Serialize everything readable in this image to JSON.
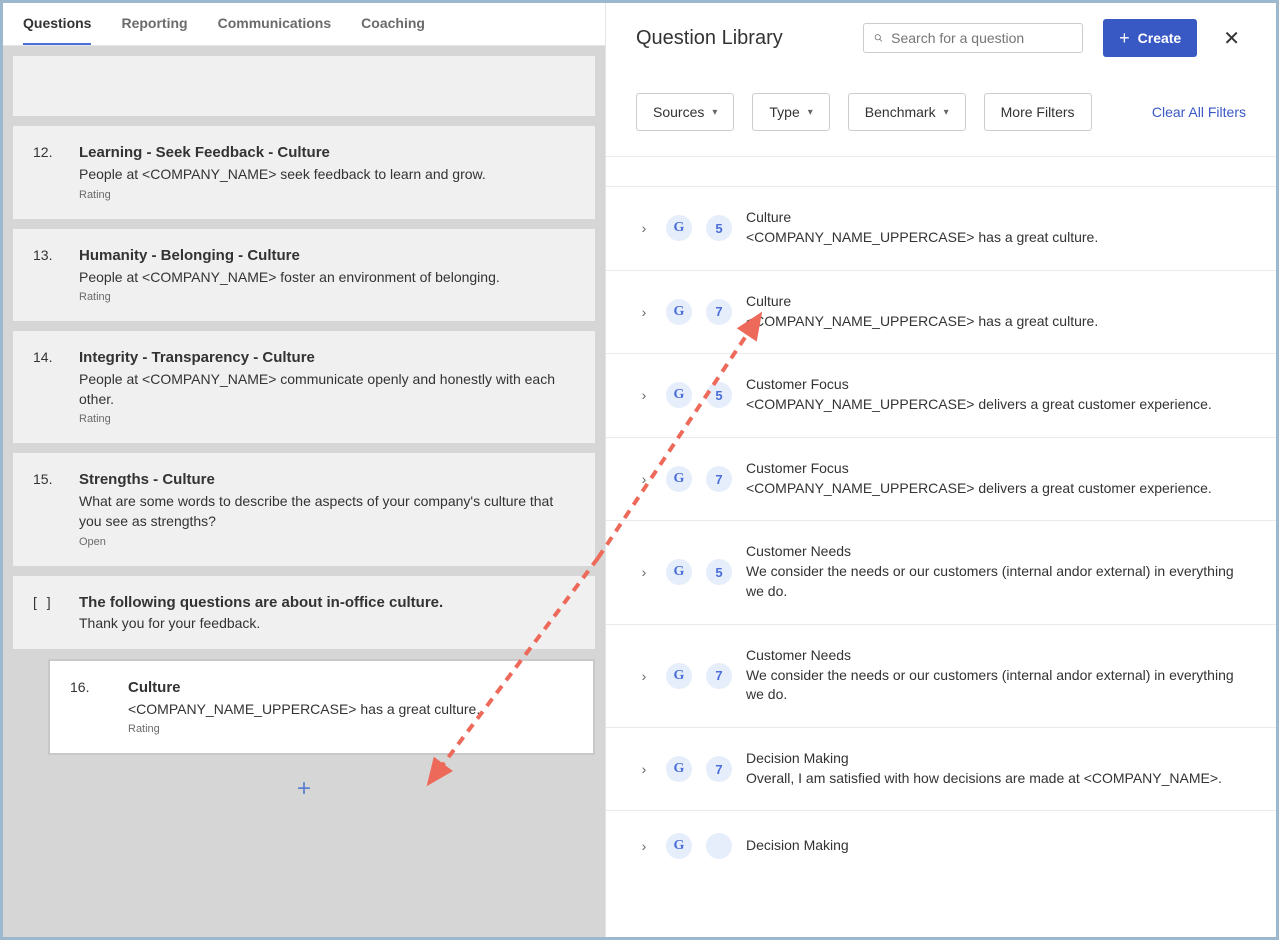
{
  "tabs": [
    "Questions",
    "Reporting",
    "Communications",
    "Coaching"
  ],
  "active_tab": "Questions",
  "questions": [
    {
      "num": "12.",
      "title": "Learning - Seek Feedback - Culture",
      "desc": "People at <COMPANY_NAME> seek feedback to learn and grow.",
      "type": "Rating"
    },
    {
      "num": "13.",
      "title": "Humanity - Belonging - Culture",
      "desc": "People at <COMPANY_NAME> foster an environment of belonging.",
      "type": "Rating"
    },
    {
      "num": "14.",
      "title": "Integrity - Transparency - Culture",
      "desc": "People at <COMPANY_NAME> communicate openly and honestly with each other.",
      "type": "Rating"
    },
    {
      "num": "15.",
      "title": "Strengths - Culture",
      "desc": "What are some words to describe the aspects of your company's culture that you see as strengths?",
      "type": "Open"
    }
  ],
  "section": {
    "title": "The following questions are about in-office culture.",
    "desc": "Thank you for your feedback."
  },
  "added_question": {
    "num": "16.",
    "title": "Culture",
    "desc": "<COMPANY_NAME_UPPERCASE> has a great culture.",
    "type": "Rating"
  },
  "panel": {
    "title": "Question Library",
    "search_placeholder": "Search for a question",
    "create_label": "Create",
    "filters": {
      "sources": "Sources",
      "type": "Type",
      "benchmark": "Benchmark",
      "more": "More Filters",
      "clear": "Clear All Filters"
    }
  },
  "library": [
    {
      "badge": "5",
      "category": "Culture",
      "text": "<COMPANY_NAME_UPPERCASE> has a great culture."
    },
    {
      "badge": "7",
      "category": "Culture",
      "text": "<COMPANY_NAME_UPPERCASE> has a great culture."
    },
    {
      "badge": "5",
      "category": "Customer Focus",
      "text": "<COMPANY_NAME_UPPERCASE> delivers a great customer experience."
    },
    {
      "badge": "7",
      "category": "Customer Focus",
      "text": "<COMPANY_NAME_UPPERCASE> delivers a great customer experience."
    },
    {
      "badge": "5",
      "category": "Customer Needs",
      "text": "We consider the needs or our customers (internal andor external) in everything we do."
    },
    {
      "badge": "7",
      "category": "Customer Needs",
      "text": "We consider the needs or our customers (internal andor external) in everything we do."
    },
    {
      "badge": "7",
      "category": "Decision Making",
      "text": "Overall, I am satisfied with how decisions are made at <COMPANY_NAME>."
    },
    {
      "badge": "",
      "category": "Decision Making",
      "text": ""
    }
  ]
}
